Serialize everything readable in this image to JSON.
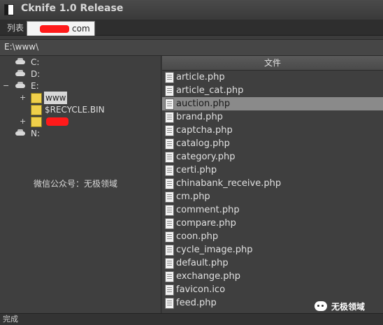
{
  "window": {
    "title": "Cknife 1.0 Release"
  },
  "tabs": {
    "list_label": "列表",
    "site_suffix": "com"
  },
  "path": {
    "value": "E:\\www\\"
  },
  "tree": {
    "drive_c": "C:",
    "drive_d": "D:",
    "drive_e": "E:",
    "folder_www": "www",
    "folder_recycle": "$RECYCLE.BIN",
    "drive_n": "N:",
    "expander_minus": "−",
    "expander_plus": "+"
  },
  "watermark": {
    "left": "微信公众号：无极领域",
    "right": "无极领域"
  },
  "list": {
    "header": "文件",
    "files": [
      "article.php",
      "article_cat.php",
      "auction.php",
      "brand.php",
      "captcha.php",
      "catalog.php",
      "category.php",
      "certi.php",
      "chinabank_receive.php",
      "cm.php",
      "comment.php",
      "compare.php",
      "coon.php",
      "cycle_image.php",
      "default.php",
      "exchange.php",
      "favicon.ico",
      "feed.php"
    ],
    "selected_index": 2
  },
  "status": {
    "text": "完成"
  },
  "colors": {
    "redaction": "#ff1a1a",
    "selection": "#8a8a8a",
    "folder": "#f0d04a"
  },
  "icons": {
    "drive": "drive-icon",
    "folder": "folder-icon",
    "file": "file-icon"
  }
}
